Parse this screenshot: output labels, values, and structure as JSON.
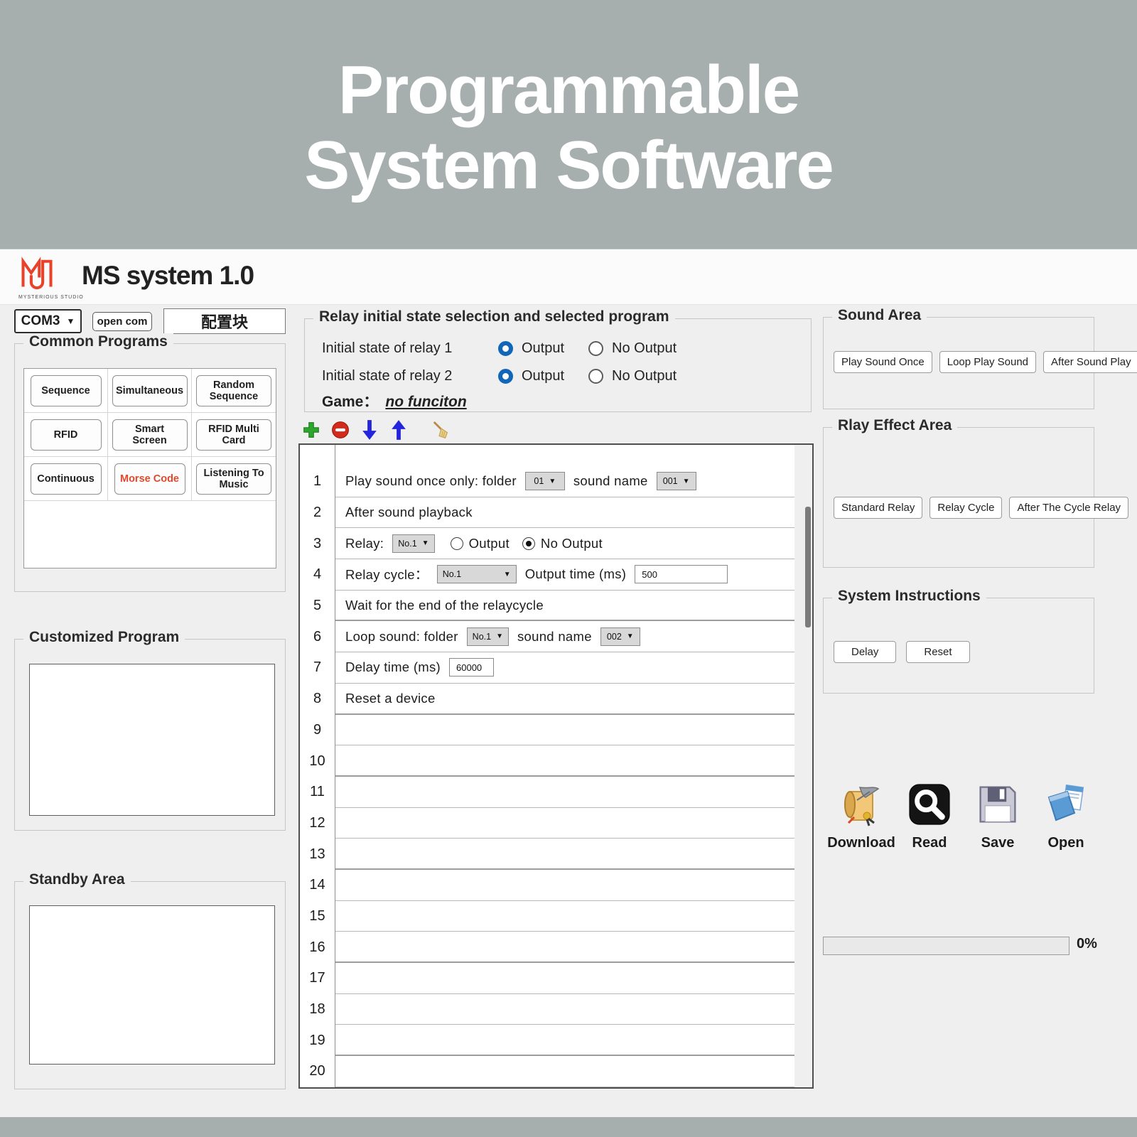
{
  "banner": {
    "line1": "Programmable",
    "line2": "System Software"
  },
  "header": {
    "app_title": "MS system 1.0",
    "studio_name": "MYSTERIOUS STUDIO"
  },
  "connection": {
    "com_port": "COM3",
    "open_com_label": "open com",
    "config_label": "配置块"
  },
  "common_programs": {
    "title": "Common Programs",
    "buttons": [
      {
        "label": "Sequence"
      },
      {
        "label": "Simultaneous"
      },
      {
        "label": "Random Sequence"
      },
      {
        "label": "RFID"
      },
      {
        "label": "Smart Screen"
      },
      {
        "label": "RFID Multi Card"
      },
      {
        "label": "Continuous"
      },
      {
        "label": "Morse Code",
        "accent": true
      },
      {
        "label": "Listening To Music"
      }
    ]
  },
  "customized_program": {
    "title": "Customized Program"
  },
  "standby_area": {
    "title": "Standby Area"
  },
  "relay_group": {
    "title": "Relay initial state selection and selected program",
    "rows": [
      {
        "label": "Initial state of relay 1",
        "options": [
          {
            "label": "Output",
            "selected": true
          },
          {
            "label": "No Output",
            "selected": false
          }
        ]
      },
      {
        "label": "Initial state of relay 2",
        "options": [
          {
            "label": "Output",
            "selected": true
          },
          {
            "label": "No Output",
            "selected": false
          }
        ]
      }
    ],
    "game_label": "Game：",
    "game_value": "no funciton"
  },
  "program_list": {
    "rows": [
      {
        "num": "1",
        "parts": [
          {
            "kind": "text",
            "value": "Play sound once only: folder"
          },
          {
            "kind": "select",
            "value": "01",
            "name": "folder-dropdown"
          },
          {
            "kind": "text",
            "value": "sound name"
          },
          {
            "kind": "select",
            "value": "001",
            "name": "sound-name-dropdown"
          }
        ]
      },
      {
        "num": "2",
        "parts": [
          {
            "kind": "text",
            "value": "After sound playback"
          }
        ]
      },
      {
        "num": "3",
        "parts": [
          {
            "kind": "text",
            "value": "Relay:"
          },
          {
            "kind": "select",
            "value": "No.1",
            "name": "relay-dropdown"
          },
          {
            "kind": "radio",
            "value": "Output",
            "checked": false
          },
          {
            "kind": "radio",
            "value": "No Output",
            "checked": true
          }
        ]
      },
      {
        "num": "4",
        "parts": [
          {
            "kind": "text",
            "value": "Relay cycle："
          },
          {
            "kind": "select",
            "value": "No.1",
            "wide": true,
            "name": "relay-cycle-dropdown"
          },
          {
            "kind": "text",
            "value": "Output time (ms)"
          },
          {
            "kind": "input",
            "value": "500",
            "size": "lg"
          }
        ],
        "thick": false
      },
      {
        "num": "5",
        "parts": [
          {
            "kind": "text",
            "value": "Wait for the end of the relaycycle"
          }
        ],
        "thick": true
      },
      {
        "num": "6",
        "parts": [
          {
            "kind": "text",
            "value": "Loop sound: folder"
          },
          {
            "kind": "select",
            "value": "No.1",
            "name": "folder-dropdown"
          },
          {
            "kind": "text",
            "value": "sound name"
          },
          {
            "kind": "select",
            "value": "002",
            "name": "sound-name-dropdown"
          }
        ]
      },
      {
        "num": "7",
        "parts": [
          {
            "kind": "text",
            "value": "Delay time (ms)"
          },
          {
            "kind": "input",
            "value": "60000",
            "size": "sm"
          }
        ]
      },
      {
        "num": "8",
        "parts": [
          {
            "kind": "text",
            "value": "Reset a device"
          }
        ],
        "thick": true
      },
      {
        "num": "9",
        "parts": []
      },
      {
        "num": "10",
        "parts": [],
        "thick": true
      },
      {
        "num": "11",
        "parts": []
      },
      {
        "num": "12",
        "parts": []
      },
      {
        "num": "13",
        "parts": [],
        "thick": true
      },
      {
        "num": "14",
        "parts": []
      },
      {
        "num": "15",
        "parts": []
      },
      {
        "num": "16",
        "parts": [],
        "thick": true
      },
      {
        "num": "17",
        "parts": []
      },
      {
        "num": "18",
        "parts": []
      },
      {
        "num": "19",
        "parts": [],
        "thick": true
      },
      {
        "num": "20",
        "parts": []
      }
    ]
  },
  "sound_area": {
    "title": "Sound Area",
    "buttons": [
      "Play Sound Once",
      "Loop Play Sound",
      "After Sound Play"
    ]
  },
  "relay_effect_area": {
    "title": "Rlay Effect Area",
    "buttons": [
      "Standard Relay",
      "Relay Cycle",
      "After The Cycle Relay"
    ]
  },
  "system_instructions": {
    "title": "System Instructions",
    "buttons": [
      "Delay",
      "Reset"
    ]
  },
  "actions": [
    {
      "icon": "download-icon",
      "label": "Download"
    },
    {
      "icon": "read-icon",
      "label": "Read"
    },
    {
      "icon": "save-icon",
      "label": "Save"
    },
    {
      "icon": "open-icon",
      "label": "Open"
    }
  ],
  "progress": {
    "value": 0,
    "percent_label": "0%"
  },
  "colors": {
    "accent_red": "#e0492d",
    "radio_blue": "#1266b8",
    "banner_gray": "#a6aeae"
  }
}
